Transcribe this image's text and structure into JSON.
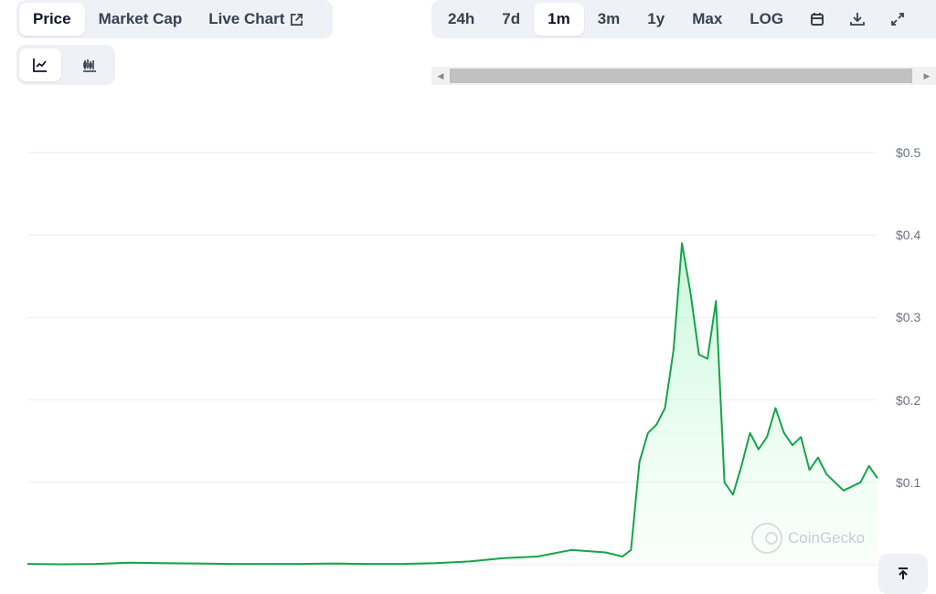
{
  "tabs": {
    "metric": [
      {
        "label": "Price",
        "active": true
      },
      {
        "label": "Market Cap",
        "active": false
      },
      {
        "label": "Live Chart",
        "active": false
      }
    ],
    "range": [
      {
        "label": "24h",
        "active": false
      },
      {
        "label": "7d",
        "active": false
      },
      {
        "label": "1m",
        "active": true
      },
      {
        "label": "3m",
        "active": false
      },
      {
        "label": "1y",
        "active": false
      },
      {
        "label": "Max",
        "active": false
      },
      {
        "label": "LOG",
        "active": false
      }
    ],
    "chart_type": [
      {
        "icon": "line-chart-icon",
        "active": true
      },
      {
        "icon": "candlestick-chart-icon",
        "active": false
      }
    ],
    "tool_icons": [
      "calendar-icon",
      "download-icon",
      "expand-icon"
    ]
  },
  "watermark": "CoinGecko",
  "colors": {
    "line": "#16a34a",
    "fill": "#dcfce7",
    "accent": "#eef1f5"
  },
  "chart_data": {
    "type": "area",
    "x": [
      0,
      4,
      8,
      12,
      16,
      20,
      24,
      28,
      32,
      36,
      40,
      44,
      48,
      52,
      56,
      60,
      64,
      68,
      70,
      71,
      72,
      73,
      74,
      75,
      76,
      77,
      78,
      79,
      80,
      81,
      82,
      83,
      84,
      85,
      86,
      87,
      88,
      89,
      90,
      91,
      92,
      93,
      94,
      95,
      96,
      97,
      98,
      99,
      100
    ],
    "values": [
      0.001,
      0.0005,
      0.001,
      0.0025,
      0.002,
      0.0015,
      0.001,
      0.001,
      0.001,
      0.0015,
      0.001,
      0.001,
      0.002,
      0.004,
      0.008,
      0.01,
      0.018,
      0.015,
      0.01,
      0.018,
      0.125,
      0.16,
      0.17,
      0.19,
      0.26,
      0.39,
      0.33,
      0.255,
      0.25,
      0.32,
      0.1,
      0.085,
      0.12,
      0.16,
      0.14,
      0.155,
      0.19,
      0.16,
      0.145,
      0.155,
      0.115,
      0.13,
      0.11,
      0.1,
      0.09,
      0.095,
      0.1,
      0.12,
      0.105
    ],
    "ylim": [
      0,
      0.5
    ],
    "yticks": [
      "$0.1",
      "$0.2",
      "$0.3",
      "$0.4",
      "$0.5"
    ],
    "ytick_values": [
      0.1,
      0.2,
      0.3,
      0.4,
      0.5
    ],
    "grid": true
  }
}
